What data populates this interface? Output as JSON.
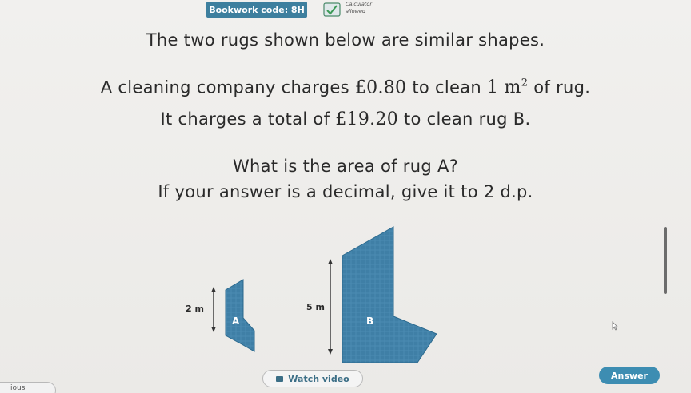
{
  "header": {
    "bookwork_label": "Bookwork code: 8H",
    "calculator_status": [
      "Calculator",
      "allowed"
    ]
  },
  "question": {
    "line1": "The two rugs shown below are similar shapes.",
    "line2_pre": "A cleaning company charges ",
    "line2_price": "£0.80",
    "line2_mid": " to clean ",
    "line2_area": "1 m",
    "line2_exp": "2",
    "line2_post": " of rug.",
    "line3_pre": "It charges a total of ",
    "line3_total": "£19.20",
    "line3_post": " to clean rug B.",
    "line4": "What is the area of rug A?",
    "line5": "If your answer is a decimal, give it to 2 d.p."
  },
  "diagram": {
    "rug_a_length": "2 m",
    "rug_b_length": "5 m",
    "rug_a_label": "A",
    "rug_b_label": "B",
    "rug_color": "#3f7fa6"
  },
  "actions": {
    "watch_video": "Watch video",
    "answer": "Answer",
    "previous": "ious"
  }
}
